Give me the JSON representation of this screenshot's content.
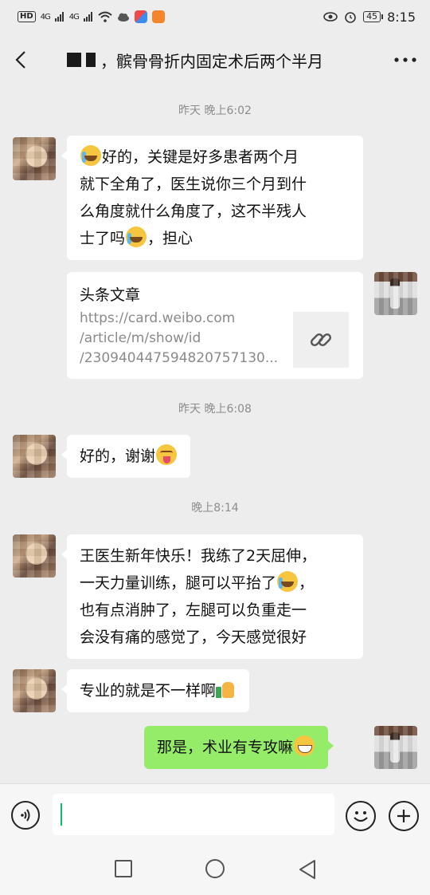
{
  "status_bar": {
    "left_glyphs": "HD",
    "network1": "4G",
    "network2": "4G",
    "battery": "45",
    "time": "8:15"
  },
  "header": {
    "title": "，髌骨骨折内固定术后两个半月"
  },
  "messages": [
    {
      "type": "timestamp",
      "text": "昨天 晚上6:02"
    },
    {
      "type": "text",
      "side": "left",
      "parts": [
        "好的，关键是好多患者两个月",
        "就下全角了，医生说你三个月到什",
        "么角度就什么角度了，这不半残人",
        "士了吗",
        "，担心"
      ]
    },
    {
      "type": "link_card",
      "side": "right",
      "title": "头条文章",
      "desc_lines": [
        "https://card.weibo.com",
        "/article/m/show/id",
        "/230940447594820757130..."
      ],
      "icon": "link-icon"
    },
    {
      "type": "timestamp",
      "text": "昨天 晚上6:08"
    },
    {
      "type": "text",
      "side": "left",
      "text": "好的，谢谢"
    },
    {
      "type": "timestamp",
      "text": "晚上8:14"
    },
    {
      "type": "text",
      "side": "left",
      "parts": [
        "王医生新年快乐！我练了2天屈伸，",
        "一天力量训练，腿可以平抬了",
        "，",
        "也有点消肿了，左腿可以负重走一",
        "会没有痛的感觉了，今天感觉很好"
      ]
    },
    {
      "type": "text",
      "side": "left",
      "text": "专业的就是不一样啊"
    },
    {
      "type": "text",
      "side": "right",
      "text": "那是，术业有专攻嘛"
    }
  ],
  "input_bar": {
    "text": "",
    "voice_icon": "voice-icon",
    "emoji_icon": "emoji-icon",
    "plus_icon": "plus-icon"
  },
  "colors": {
    "background": "#ededed",
    "bubble_self": "#95ec69",
    "bubble_other": "#ffffff",
    "accent": "#07c160"
  }
}
